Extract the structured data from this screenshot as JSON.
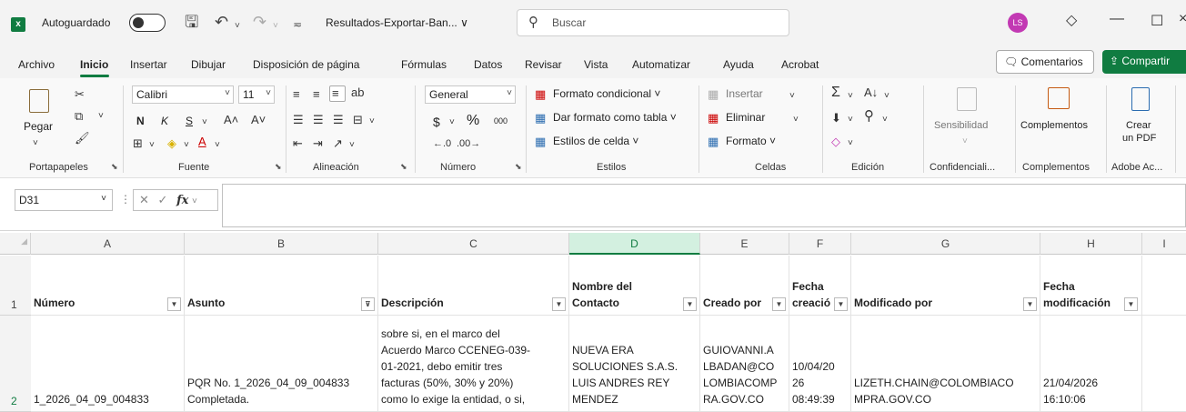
{
  "titlebar": {
    "app_icon": "excel-icon",
    "autosave_label": "Autoguardado",
    "filename": "Resultados-Exportar-Ban... ∨",
    "search_placeholder": "Buscar",
    "avatar_initials": "LS"
  },
  "menu": {
    "tabs": [
      "Archivo",
      "Inicio",
      "Insertar",
      "Dibujar",
      "Disposición de página",
      "Fórmulas",
      "Datos",
      "Revisar",
      "Vista",
      "Automatizar",
      "Ayuda",
      "Acrobat"
    ],
    "active_tab": "Inicio",
    "comments_label": "Comentarios",
    "share_label": "Compartir"
  },
  "ribbon": {
    "paste_label": "Pegar",
    "font_name": "Calibri",
    "font_size": "11",
    "bold": "N",
    "italic": "K",
    "underline": "S",
    "number_format": "General",
    "currency": "$",
    "percent": "%",
    "thousands": "000",
    "cond_format": "Formato condicional ˅",
    "format_table": "Dar formato como tabla ˅",
    "cell_styles": "Estilos de celda ˅",
    "insert": "Insertar",
    "delete": "Eliminar",
    "format": "Formato ˅",
    "sensitivity": "Sensibilidad",
    "addins": "Complementos",
    "create_pdf_line1": "Crear",
    "create_pdf_line2": "un PDF",
    "groups": [
      "Portapapeles",
      "Fuente",
      "Alineación",
      "Número",
      "Estilos",
      "Celdas",
      "Edición",
      "Confidenciali...",
      "Complementos",
      "Adobe Ac..."
    ]
  },
  "formula_bar": {
    "name_box": "D31",
    "fx": "fx",
    "content": ""
  },
  "grid": {
    "columns": [
      "A",
      "B",
      "C",
      "D",
      "E",
      "F",
      "G",
      "H",
      "I"
    ],
    "selected_column": "D",
    "rows": [
      "1",
      "2"
    ],
    "headers": {
      "A": "Número",
      "B": "Asunto",
      "C": "Descripción",
      "D": "Nombre del\nContacto",
      "E": "Creado por",
      "F": "Fecha\ncreació",
      "G": "Modificado por",
      "H": "Fecha\nmodificación"
    },
    "row2": {
      "A": "1_2026_04_09_004833",
      "B": "PQR No. 1_2026_04_09_004833\nCompletada.",
      "C": "sobre si, en el marco del\nAcuerdo Marco CCENEG-039-\n01-2021, debo emitir tres\nfacturas (50%, 30% y 20%)\ncomo lo exige la entidad, o si,",
      "D": "NUEVA ERA\nSOLUCIONES S.A.S.\nLUIS ANDRES REY\nMENDEZ",
      "E": "GUIOVANNI.A\nLBADAN@CO\nLOMBIACOMP\nRA.GOV.CO",
      "F": "10/04/20\n26\n08:49:39",
      "G": "LIZETH.CHAIN@COLOMBIACO\nMPRA.GOV.CO",
      "H": "21/04/2026\n16:10:06"
    }
  }
}
